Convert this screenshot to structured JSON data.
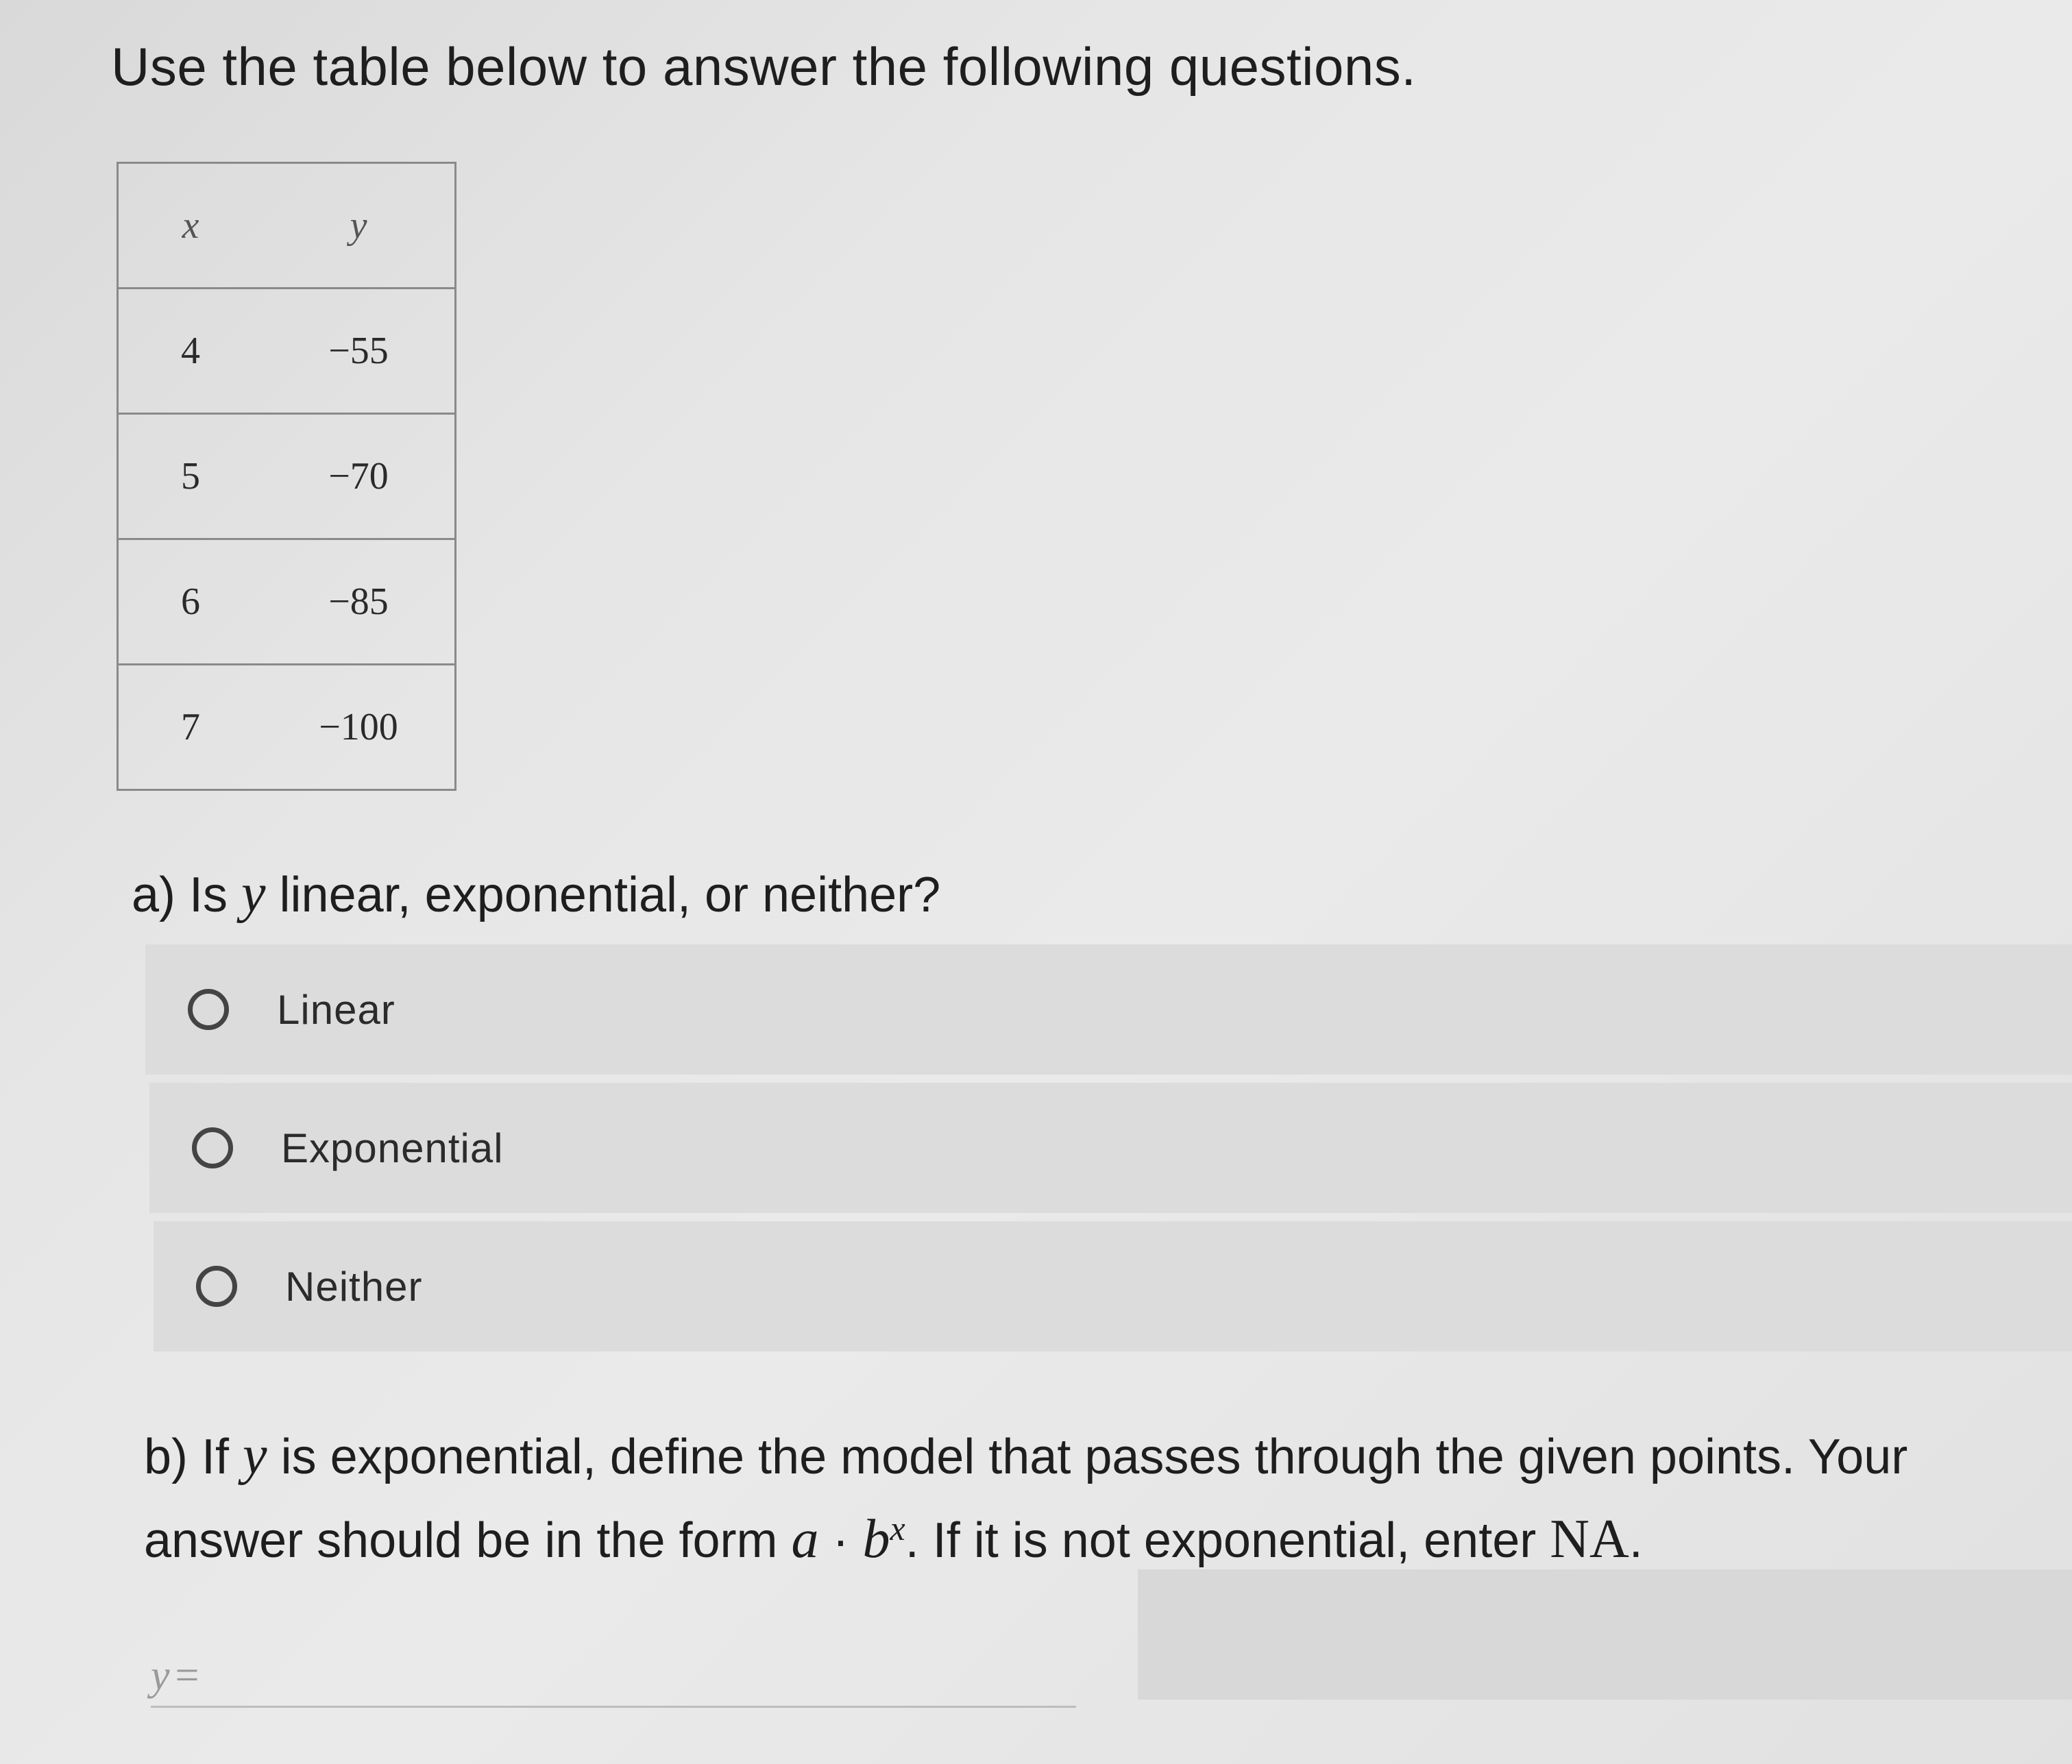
{
  "heading": "Use the table below to answer the following questions.",
  "table": {
    "headers": [
      "x",
      "y"
    ],
    "rows": [
      [
        "4",
        "−55"
      ],
      [
        "5",
        "−70"
      ],
      [
        "6",
        "−85"
      ],
      [
        "7",
        "−100"
      ]
    ]
  },
  "question_a": {
    "prefix": "a) Is ",
    "var": "y",
    "suffix": " linear, exponential, or neither?",
    "options": [
      "Linear",
      "Exponential",
      "Neither"
    ]
  },
  "question_b": {
    "p1": "b) If ",
    "var1": "y",
    "p2": " is exponential, define the model that passes through the given points. Your answer should be in the form ",
    "math_a": "a",
    "dot": " · ",
    "math_b": "b",
    "math_exp": "x",
    "p3": ". If it is not exponential, enter ",
    "math_na": "NA",
    "p4": "."
  },
  "answer": {
    "prefix_var": "y",
    "prefix_eq": "=",
    "value": ""
  }
}
